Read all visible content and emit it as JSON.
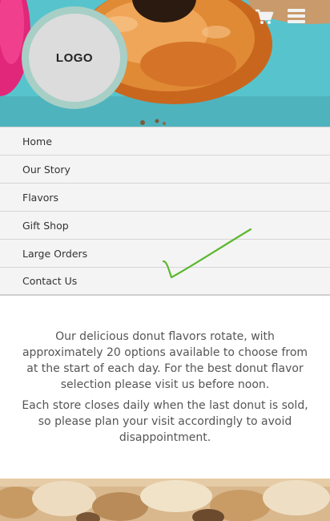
{
  "header": {
    "logo_text": "LOGO",
    "cart_icon": "shopping-cart-icon",
    "menu_icon": "hamburger-menu-icon"
  },
  "nav": {
    "items": [
      {
        "label": "Home"
      },
      {
        "label": "Our Story"
      },
      {
        "label": "Flavors"
      },
      {
        "label": "Gift Shop"
      },
      {
        "label": "Large Orders"
      },
      {
        "label": "Contact Us"
      }
    ]
  },
  "content": {
    "paragraph_1": "Our delicious donut flavors rotate, with approximately 20 options available to choose from at the start of each day. For the best donut flavor selection please visit us before noon.",
    "paragraph_2": "Each store closes daily when the last donut is sold, so please plan your visit accordingly to avoid disappointment."
  },
  "colors": {
    "hero_bg": "#58c6cf",
    "logo_ring": "#a7cfc6",
    "nav_bg": "#f4f4f4",
    "checkmark": "#5cb82e"
  }
}
